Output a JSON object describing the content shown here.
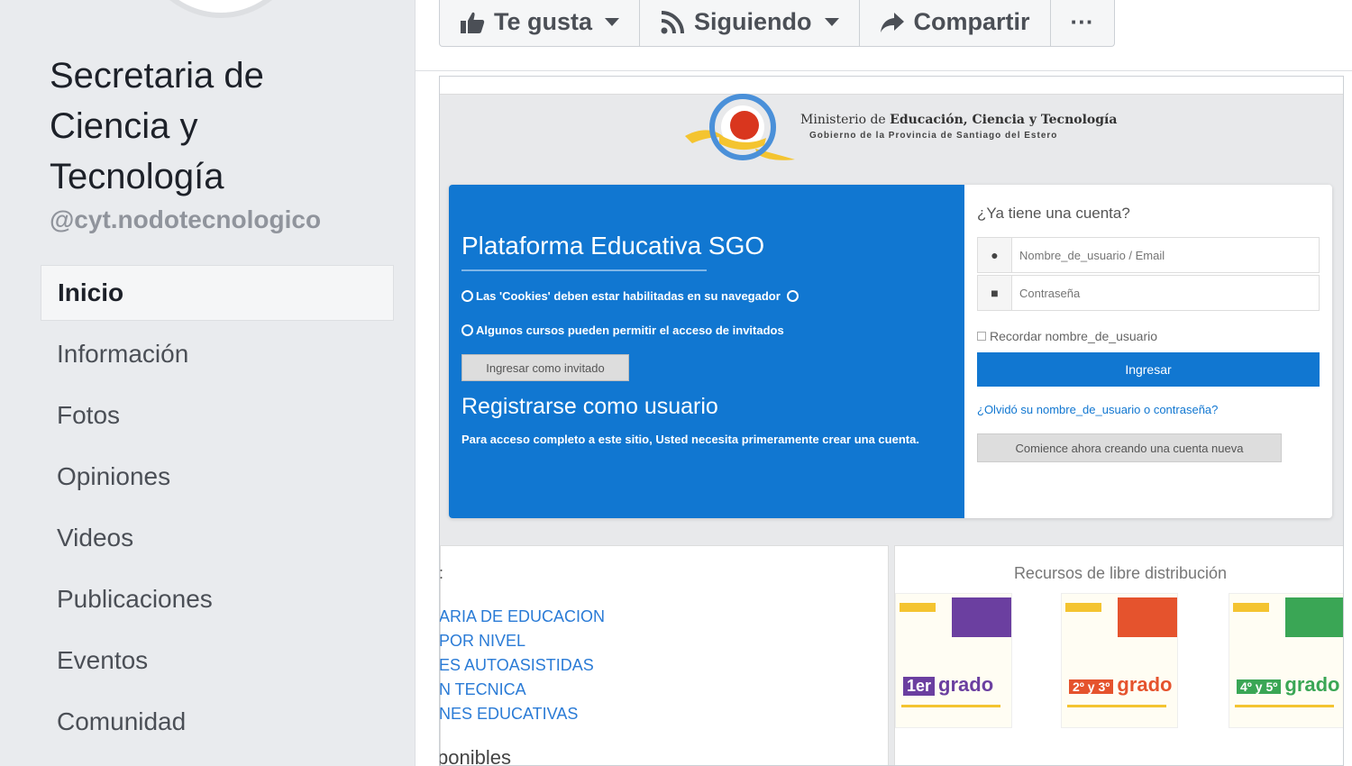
{
  "sidebar": {
    "page_name": "Secretaria de Ciencia y Tecnología",
    "handle": "@cyt.nodotecnologico",
    "nav": [
      {
        "label": "Inicio",
        "active": true
      },
      {
        "label": "Información"
      },
      {
        "label": "Fotos"
      },
      {
        "label": "Opiniones"
      },
      {
        "label": "Videos"
      },
      {
        "label": "Publicaciones"
      },
      {
        "label": "Eventos"
      },
      {
        "label": "Comunidad"
      }
    ]
  },
  "actions": {
    "like": "Te gusta",
    "following": "Siguiendo",
    "share": "Compartir",
    "more": "···"
  },
  "post_image": {
    "ministry": {
      "line1_pre": "Ministerio de",
      "line1_bold": "Educación, Ciencia y Tecnología",
      "line2": "Gobierno de la Provincia de Santiago del Estero"
    },
    "blue_panel": {
      "title": "Plataforma Educativa SGO",
      "cookies_note": "Las 'Cookies' deben estar habilitadas en su navegador",
      "guests_note": "Algunos cursos pueden permitir el acceso de invitados",
      "guest_button": "Ingresar como invitado",
      "register_title": "Registrarse como usuario",
      "register_text": "Para acceso completo a este sitio, Usted necesita primeramente crear una cuenta."
    },
    "login": {
      "question": "¿Ya tiene una cuenta?",
      "username_placeholder": "Nombre_de_usuario / Email",
      "password_placeholder": "Contraseña",
      "remember": "Recordar nombre_de_usuario",
      "enter_button": "Ingresar",
      "forgot": "¿Olvidó su nombre_de_usuario o contraseña?",
      "create_button": "Comience ahora creando una cuenta nueva"
    },
    "bottom_left": {
      "colon": ":",
      "links": [
        "ARIA DE EDUCACION",
        "POR NIVEL",
        "ES AUTOASISTIDAS",
        "N TECNICA",
        "NES EDUCATIVAS"
      ],
      "footer": "ponibles"
    },
    "bottom_right": {
      "title": "Recursos de libre distribución",
      "books": [
        {
          "num": "1er",
          "label": "grado",
          "color": "#6b3fa0"
        },
        {
          "num": "2º y 3º",
          "label": "grado",
          "color": "#e5532d"
        },
        {
          "num": "4º y 5º",
          "label": "grado",
          "color": "#3aa655"
        }
      ]
    }
  },
  "colors": {
    "facebook_bg": "#e9ebee",
    "platform_blue": "#1177d1",
    "link_blue": "#2a7bd6"
  }
}
